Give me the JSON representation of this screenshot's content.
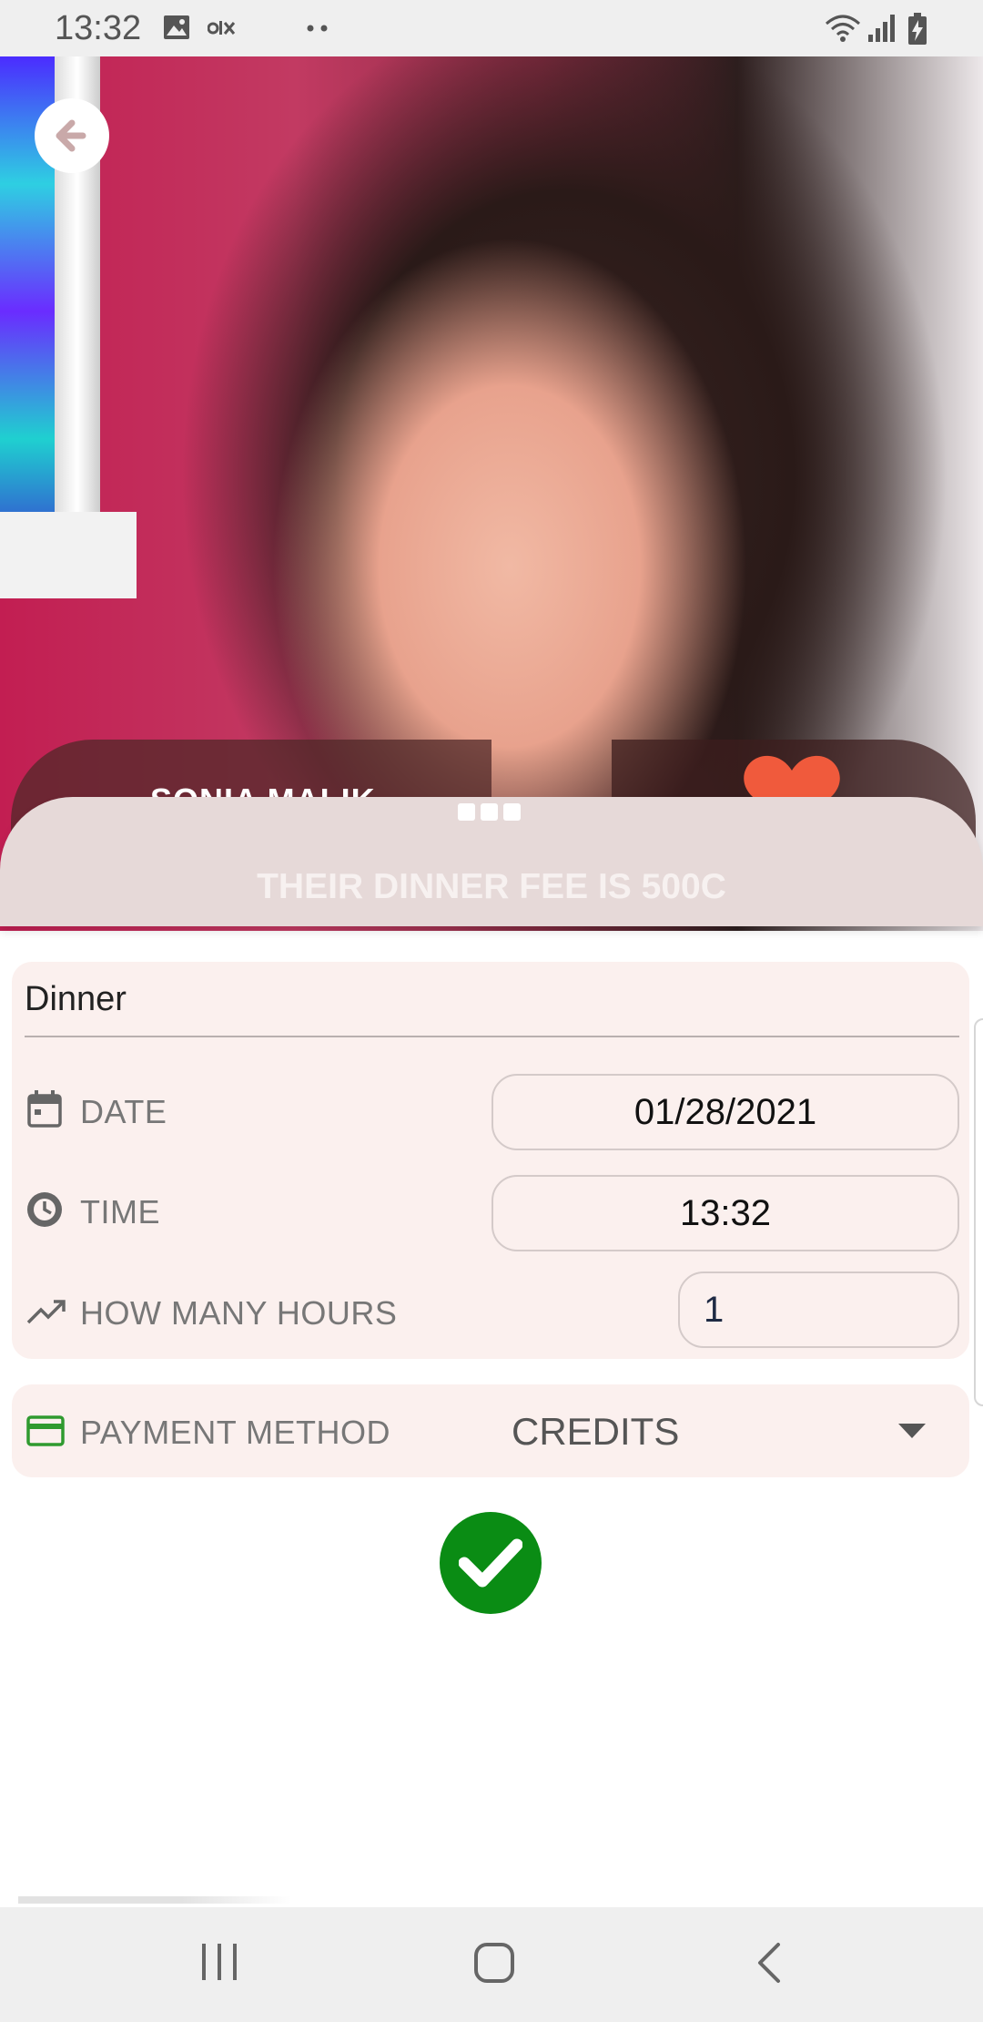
{
  "status_bar": {
    "time": "13:32",
    "icons": [
      "gallery-icon",
      "olx-icon",
      "more-dots-icon",
      "wifi-icon",
      "signal-icon",
      "battery-charging-icon"
    ]
  },
  "profile": {
    "name": "SONIA MALIK",
    "fee_text": "THEIR DINNER FEE IS 500C"
  },
  "form": {
    "event_type": "Dinner",
    "date_label": "DATE",
    "date_value": "01/28/2021",
    "time_label": "TIME",
    "time_value": "13:32",
    "hours_label": "HOW MANY HOURS",
    "hours_value": "1",
    "payment_label": "PAYMENT METHOD",
    "payment_value": "CREDITS"
  },
  "colors": {
    "confirm": "#0a8c14",
    "heart": "#f05a3c",
    "card_bg": "#fbf0ee",
    "sheet_bg": "#e6d9d8"
  }
}
